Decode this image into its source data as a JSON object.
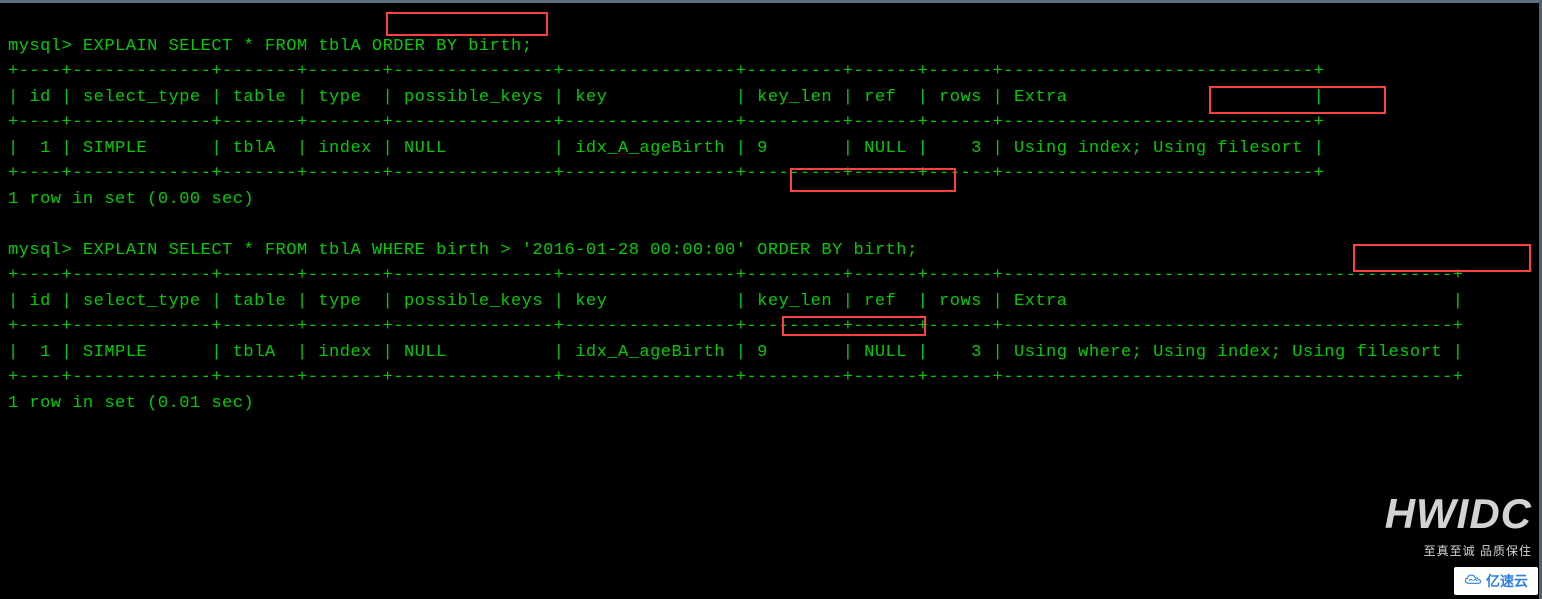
{
  "queries": [
    {
      "prompt": "mysql> ",
      "sql_before_highlight": "EXPLAIN SELECT * FROM tblA ",
      "highlighted_clause": "ORDER BY birth",
      "sql_after_highlight": ";",
      "result": {
        "headers": [
          "id",
          "select_type",
          "table",
          "type",
          "possible_keys",
          "key",
          "key_len",
          "ref",
          "rows",
          "Extra"
        ],
        "rows": [
          {
            "id": "1",
            "select_type": "SIMPLE",
            "table": "tblA",
            "type": "index",
            "possible_keys": "NULL",
            "key": "idx_A_ageBirth",
            "key_len": "9",
            "ref": "NULL",
            "rows": "3",
            "extra_before": "Using index; ",
            "extra_highlighted": "Using filesort"
          }
        ]
      },
      "footer": "1 row in set (0.00 sec)"
    },
    {
      "prompt": "mysql> ",
      "sql_before_highlight": "EXPLAIN SELECT * FROM tblA WHERE birth > '2016-01-28 00:00:00' ",
      "highlighted_clause": "ORDER BY birth",
      "sql_after_highlight": ";",
      "result": {
        "headers": [
          "id",
          "select_type",
          "table",
          "type",
          "possible_keys",
          "key",
          "key_len",
          "ref",
          "rows",
          "Extra"
        ],
        "rows": [
          {
            "id": "1",
            "select_type": "SIMPLE",
            "table": "tblA",
            "type": "index",
            "possible_keys": "NULL",
            "key": "idx_A_ageBirth",
            "key_len": "9",
            "ref": "NULL",
            "rows": "3",
            "extra_before": "Using where; Using index; ",
            "extra_highlighted": "Using filesort"
          }
        ]
      },
      "footer": "1 row in set (0.01 sec)"
    }
  ],
  "table_borders": {
    "top1": "+----+-------------+-------+-------+---------------+----------------+---------+------+------+-----------------------------+",
    "header1": "| id | select_type | table | type  | possible_keys | key            | key_len | ref  | rows | Extra                       |",
    "mid1": "+----+-------------+-------+-------+---------------+----------------+---------+------+------+-----------------------------+",
    "row1": "|  1 | SIMPLE      | tblA  | index | NULL          | idx_A_ageBirth | 9       | NULL |    3 | Using index; Using filesort |",
    "bot1": "+----+-------------+-------+-------+---------------+----------------+---------+------+------+-----------------------------+",
    "top2": "+----+-------------+-------+-------+---------------+----------------+---------+------+------+------------------------------------------+",
    "header2": "| id | select_type | table | type  | possible_keys | key            | key_len | ref  | rows | Extra                                    |",
    "mid2": "+----+-------------+-------+-------+---------------+----------------+---------+------+------+------------------------------------------+",
    "row2": "|  1 | SIMPLE      | tblA  | index | NULL          | idx_A_ageBirth | 9       | NULL |    3 | Using where; Using index; Using filesort |",
    "bot2": "+----+-------------+-------+-------+---------------+----------------+---------+------+------+------------------------------------------+"
  },
  "watermark": {
    "logo": "HWIDC",
    "slogan": "至真至诚 品质保住",
    "badge": "亿速云"
  }
}
